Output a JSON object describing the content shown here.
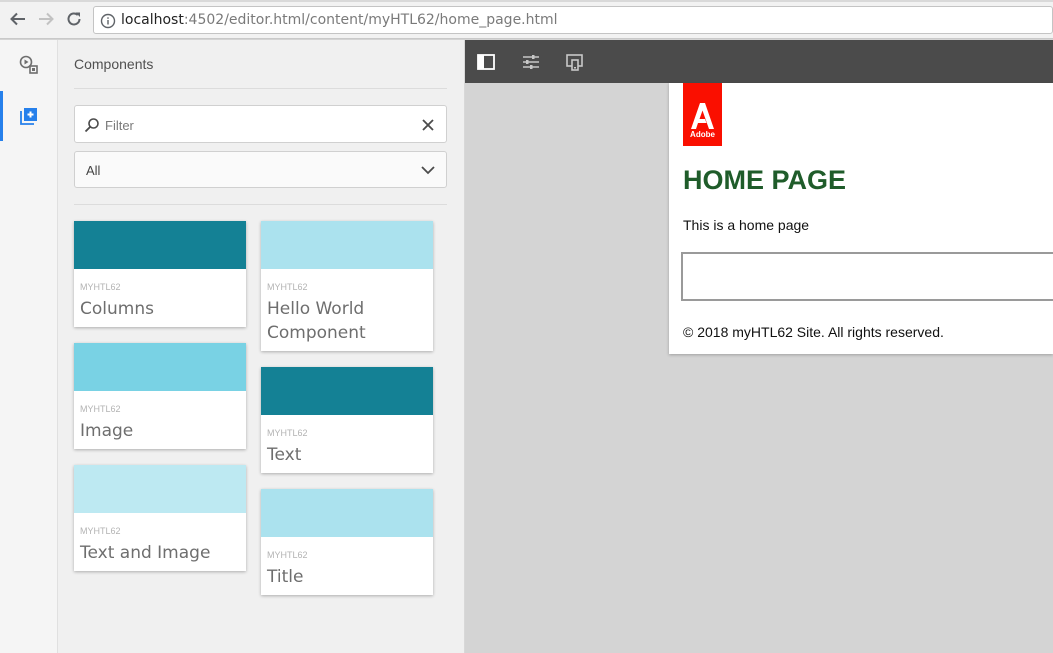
{
  "browser": {
    "url_host": "localhost",
    "url_rest": ":4502/editor.html/content/myHTL62/home_page.html"
  },
  "side_panel": {
    "title": "Components",
    "filter_placeholder": "Filter",
    "group_select_value": "All",
    "components": [
      {
        "group": "MYHTL62",
        "name": "Columns",
        "color": "#148195"
      },
      {
        "group": "MYHTL62",
        "name": "Hello World Component",
        "color": "#abe2ee"
      },
      {
        "group": "MYHTL62",
        "name": "Image",
        "color": "#79d2e4"
      },
      {
        "group": "MYHTL62",
        "name": "Text",
        "color": "#148195"
      },
      {
        "group": "MYHTL62",
        "name": "Text and Image",
        "color": "#bde9f2"
      },
      {
        "group": "MYHTL62",
        "name": "Title",
        "color": "#abe2ee"
      }
    ]
  },
  "page": {
    "logo_text": "Adobe",
    "heading": "HOME PAGE",
    "body_text": "This is a home page",
    "footer_text": "© 2018 myHTL62 Site. All rights reserved."
  },
  "colors": {
    "accent_blue": "#2680eb",
    "heading_green": "#1f5c2a",
    "adobe_red": "#fa0f00",
    "toolbar_bg": "#4b4b4b"
  }
}
